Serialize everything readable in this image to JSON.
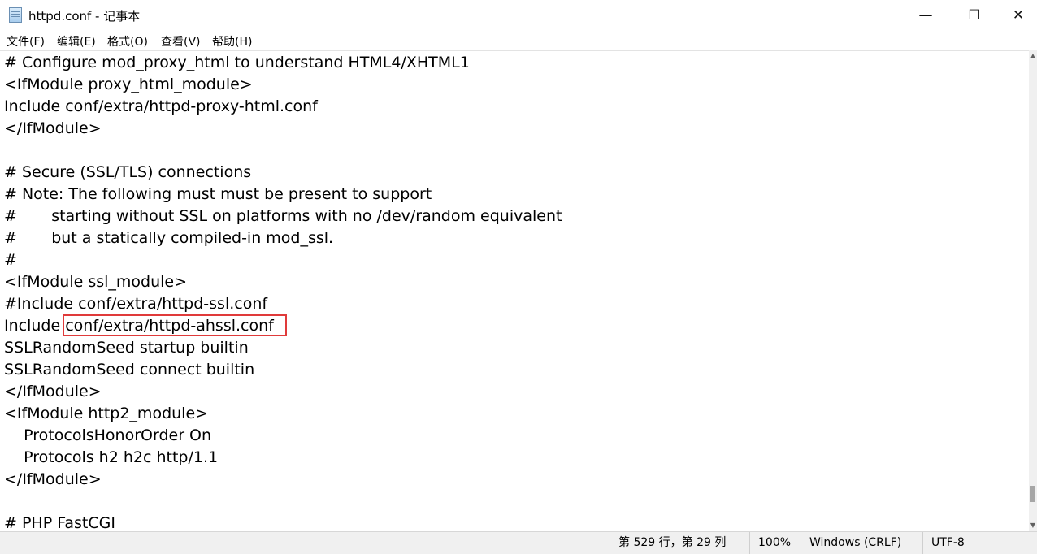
{
  "window": {
    "title": "httpd.conf - 记事本",
    "icon": "notepad-icon",
    "controls": {
      "minimize": "—",
      "maximize": "☐",
      "close": "✕"
    }
  },
  "menu": [
    {
      "label": "文件(F)"
    },
    {
      "label": "编辑(E)"
    },
    {
      "label": "格式(O)"
    },
    {
      "label": "查看(V)"
    },
    {
      "label": "帮助(H)"
    }
  ],
  "editor": {
    "lines": [
      "# Configure mod_proxy_html to understand HTML4/XHTML1",
      "<IfModule proxy_html_module>",
      "Include conf/extra/httpd-proxy-html.conf",
      "</IfModule>",
      "",
      "# Secure (SSL/TLS) connections",
      "# Note: The following must must be present to support",
      "#       starting without SSL on platforms with no /dev/random equivalent",
      "#       but a statically compiled-in mod_ssl.",
      "#",
      "<IfModule ssl_module>",
      "#Include conf/extra/httpd-ssl.conf",
      "Include conf/extra/httpd-ahssl.conf",
      "SSLRandomSeed startup builtin",
      "SSLRandomSeed connect builtin",
      "</IfModule>",
      "<IfModule http2_module>",
      "    ProtocolsHonorOrder On",
      "    Protocols h2 h2c http/1.1",
      "</IfModule>",
      "",
      "# PHP FastCGI"
    ],
    "highlight_color": "#e03a3a"
  },
  "status": {
    "position": "第 529 行，第 29 列",
    "zoom": "100%",
    "line_ending": "Windows (CRLF)",
    "encoding": "UTF-8"
  }
}
